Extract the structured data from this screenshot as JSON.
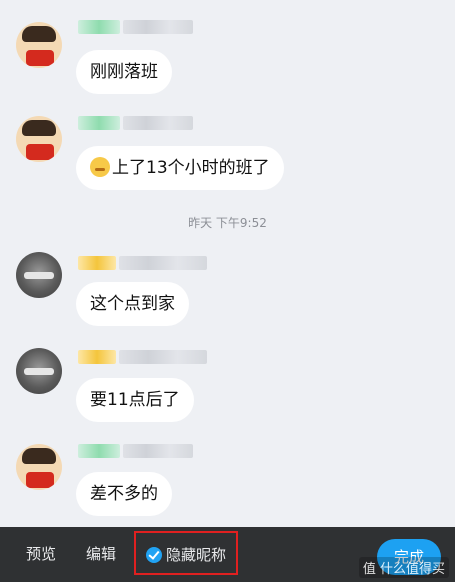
{
  "messages": [
    {
      "avatar": "kid-avatar",
      "nick_tag": "green",
      "text": "刚刚落班"
    },
    {
      "avatar": "kid-avatar",
      "nick_tag": "green",
      "emoji": "grimace-emoji",
      "text": "上了13个小时的班了"
    },
    {
      "avatar": "gray-avatar",
      "nick_tag": "yellow",
      "text": "这个点到家"
    },
    {
      "avatar": "gray-avatar",
      "nick_tag": "yellow",
      "text": "要11点后了"
    },
    {
      "avatar": "kid-avatar",
      "nick_tag": "green",
      "text": "差不多的"
    }
  ],
  "timestamp": "昨天 下午9:52",
  "toolbar": {
    "preview_label": "预览",
    "edit_label": "编辑",
    "hide_nick_label": "隐藏昵称",
    "hide_nick_checked": true,
    "done_label": "完成"
  },
  "watermark": "值 什么值得买",
  "colors": {
    "toolbar_bg": "#2f3133",
    "accent_blue": "#1da1f2",
    "highlight_red": "#e02020",
    "chat_bg": "#eef0f4"
  }
}
